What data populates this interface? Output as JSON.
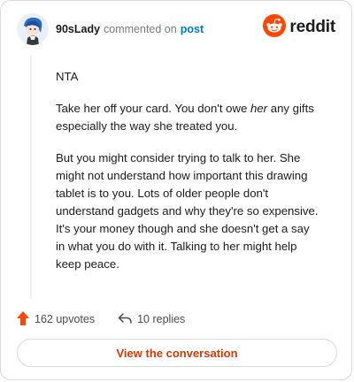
{
  "author": {
    "username": "90sLady",
    "action_text": "commented on",
    "post_link": "post",
    "avatar_icon": "snoo-avatar-icon"
  },
  "brand": {
    "name": "reddit",
    "logo_icon": "reddit-snoo-logo-icon",
    "color": "#ff4500"
  },
  "comment": {
    "paragraphs": [
      {
        "text": "NTA"
      },
      {
        "before": "Take her off your card. You don't owe ",
        "emphasis": "her",
        "after": " any gifts especially the way she treated you."
      },
      {
        "text": "But you might consider trying to talk to her. She might not understand how important this drawing tablet is to you. Lots of older people don't understand gadgets and why they're so expensive. It's your money though and she doesn't get a say in what you do with it. Talking to her might help keep peace."
      }
    ]
  },
  "stats": {
    "upvotes": "162 upvotes",
    "replies": "10 replies",
    "upvote_icon": "upvote-arrow-icon",
    "reply_icon": "reply-arrow-icon",
    "upvote_color": "#ff4500"
  },
  "cta": {
    "label": "View the conversation",
    "color": "#d93900"
  }
}
